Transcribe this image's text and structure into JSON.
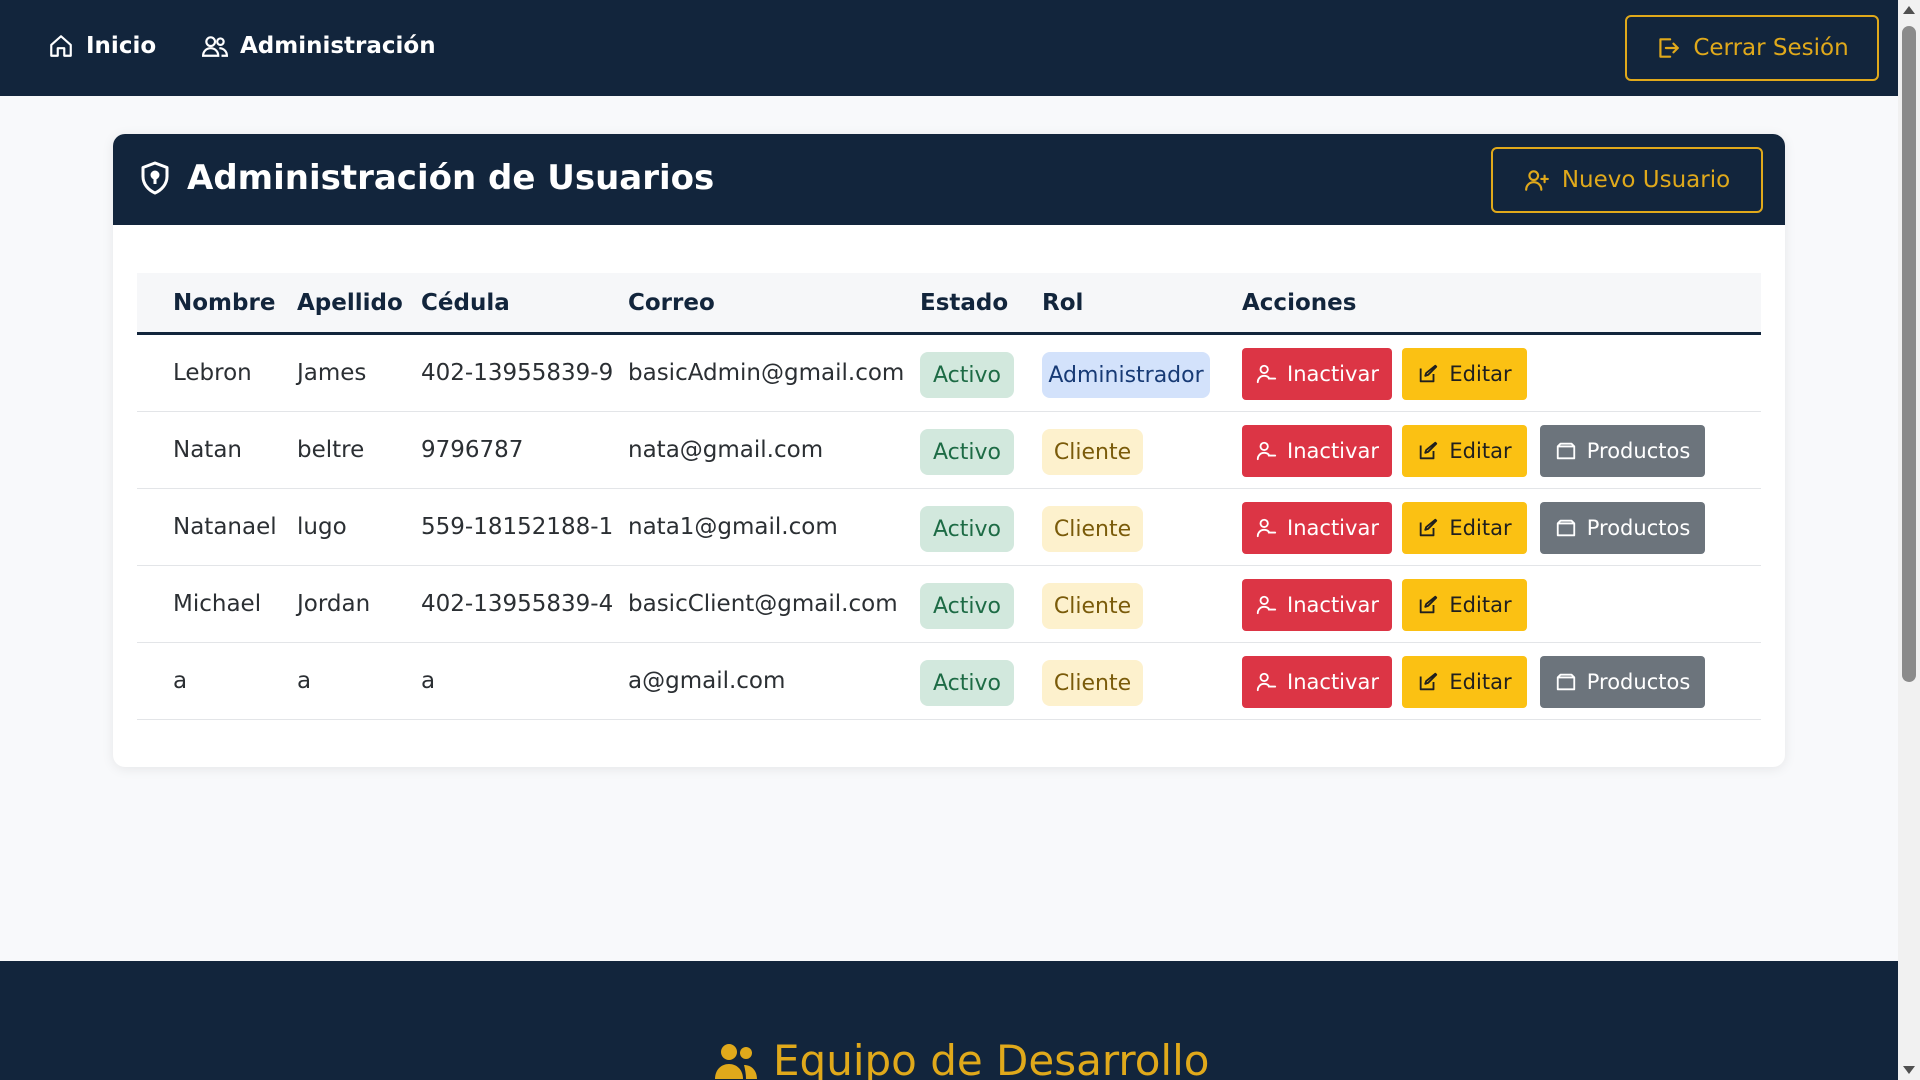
{
  "nav": {
    "home_label": "Inicio",
    "admin_label": "Administración",
    "logout_label": "Cerrar Sesión"
  },
  "card": {
    "title": "Administración de Usuarios",
    "new_user_label": "Nuevo Usuario"
  },
  "table": {
    "headers": [
      "Nombre",
      "Apellido",
      "Cédula",
      "Correo",
      "Estado",
      "Rol",
      "Acciones"
    ],
    "rows": [
      {
        "nombre": "Lebron",
        "apellido": "James",
        "cedula": "402-13955839-9",
        "correo": "basicAdmin@gmail.com",
        "estado": "Activo",
        "rol": "Administrador",
        "btn_inactivar": "Inactivar",
        "btn_editar": "Editar"
      },
      {
        "nombre": "Natan",
        "apellido": "beltre",
        "cedula": "9796787",
        "correo": "nata@gmail.com",
        "estado": "Activo",
        "rol": "Cliente",
        "btn_inactivar": "Inactivar",
        "btn_editar": "Editar",
        "btn_productos": "Productos"
      },
      {
        "nombre": "Natanael",
        "apellido": "lugo",
        "cedula": "559-18152188-1",
        "correo": "nata1@gmail.com",
        "estado": "Activo",
        "rol": "Cliente",
        "btn_inactivar": "Inactivar",
        "btn_editar": "Editar",
        "btn_productos": "Productos"
      },
      {
        "nombre": "Michael",
        "apellido": "Jordan",
        "cedula": "402-13955839-4",
        "correo": "basicClient@gmail.com",
        "estado": "Activo",
        "rol": "Cliente",
        "btn_inactivar": "Inactivar",
        "btn_editar": "Editar"
      },
      {
        "nombre": "a",
        "apellido": "a",
        "cedula": "a",
        "correo": "a@gmail.com",
        "estado": "Activo",
        "rol": "Cliente",
        "btn_inactivar": "Inactivar",
        "btn_editar": "Editar",
        "btn_productos": "Productos"
      }
    ]
  },
  "footer": {
    "title": "Equipo de Desarrollo"
  },
  "colors": {
    "navy": "#12253c",
    "gold": "#e0a91b",
    "danger": "#dc3545",
    "warning": "#fbc113",
    "secondary": "#6c747c"
  }
}
